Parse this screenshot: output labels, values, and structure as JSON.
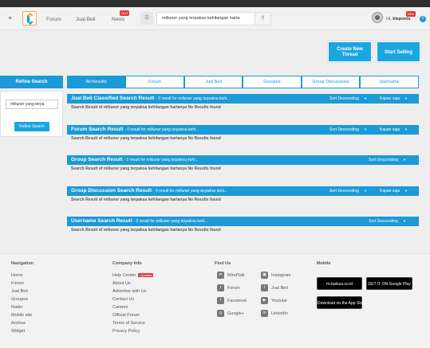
{
  "header": {
    "nav": [
      "Forum",
      "Jual Beli",
      "News"
    ],
    "hot_badge": "HOT",
    "search_value": "miliuner yang terpaksa kehilangan harta",
    "greeting_prefix": "Hi,",
    "username": "kleponis",
    "new_badge": "New",
    "help_symbol": "?"
  },
  "actions": {
    "create_thread": "Create New Thread",
    "start_selling": "Start Selling"
  },
  "refine": {
    "title": "Refine Search",
    "input_value": "miliuner yang terpa",
    "button": "Refine Search"
  },
  "tabs": [
    "All Results",
    "Forum",
    "Jual Beli",
    "Groupee",
    "Group Discussions",
    "Username"
  ],
  "sections": [
    {
      "title": "Jual Beli Classified Search Result",
      "count": "- 0 result for",
      "query": "miliuner yang terpaksa kehi...",
      "sort": "Sort Descending",
      "time": "Kapan saja",
      "body": "Search Result of miliuner yang terpaksa kehilangan hartanya No Results found"
    },
    {
      "title": "Forum Search Result",
      "count": "- 0 result for",
      "query": "miliuner yang terpaksa kehi...",
      "sort": "Sort Descending",
      "time": "Kapan saja",
      "body": "Search Result of miliuner yang terpaksa kehilangan hartanya No Results found"
    },
    {
      "title": "Group Search Result",
      "count": "- 0 result for",
      "query": "miliuner yang terpaksa kehi...",
      "sort": "Sort Descending",
      "time": "",
      "body": "Search Result of miliuner yang terpaksa kehilangan hartanya No Results found"
    },
    {
      "title": "Group Discussion Search Result",
      "count": "- 0 result for",
      "query": "miliuner yang terpaksa kehi...",
      "sort": "Sort Descending",
      "time": "Kapan saja",
      "body": "Search Result of miliuner yang terpaksa kehilangan hartanya No Results found"
    },
    {
      "title": "Username Search Result",
      "count": "- 0 result for",
      "query": "miliuner yang terpaksa kehi...",
      "sort": "Sort Descending",
      "time": "",
      "body": "Search Result of miliuner yang terpaksa kehilangan hartanya No Results found"
    }
  ],
  "footer": {
    "navigation": {
      "title": "Navigation",
      "links": [
        "Home",
        "Forum",
        "Jual Beli",
        "Groupee",
        "Radio",
        "Mobile site",
        "Archive",
        "Widget"
      ]
    },
    "company": {
      "title": "Company Info",
      "links": [
        "Help Center",
        "About Us",
        "Advertise with Us",
        "Contact Us",
        "Careers",
        "Official Forum",
        "Terms of Service",
        "Privacy Policy"
      ],
      "updated_badge": "Updated"
    },
    "findus": {
      "title": "Find Us",
      "left": [
        "MindTalk",
        "Forum",
        "Facebook",
        "Google+"
      ],
      "right": [
        "Instagram",
        "Jual Beli",
        "Youtube",
        "LinkedIn"
      ]
    },
    "mobile": {
      "title": "Mobile",
      "stores": [
        "m.kaskus.co.id",
        "GET IT ON Google Play",
        "Download on the App Store"
      ]
    }
  }
}
